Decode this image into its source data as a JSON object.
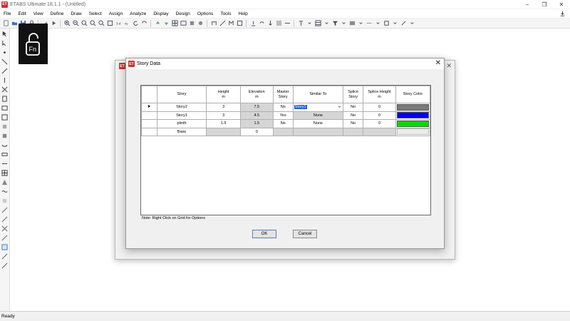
{
  "window": {
    "title": "ETABS Ultimate 18.1.1 - (Untitled)",
    "logo": "ET"
  },
  "menu": [
    "File",
    "Edit",
    "View",
    "Define",
    "Draw",
    "Select",
    "Assign",
    "Analyze",
    "Display",
    "Design",
    "Options",
    "Tools",
    "Help"
  ],
  "toolbar_icons": [
    "new-icon",
    "open-icon",
    "save-icon",
    "lock-icon",
    "pencil-icon",
    "run-icon",
    "zoom-in-icon",
    "zoom-out-icon",
    "zoom-window-icon",
    "pan-icon",
    "refresh-icon",
    "3d-view-icon",
    "rotate-icon",
    "up-arrow-icon",
    "down-arrow-icon",
    "select-icon",
    "grid-icon",
    "dropdown-icon"
  ],
  "fn_overlay": {
    "label": "Fn"
  },
  "status": {
    "text": "Ready"
  },
  "dialog": {
    "title": "Story Data",
    "logo": "ET",
    "columns": [
      {
        "line1": "Story",
        "line2": ""
      },
      {
        "line1": "Height",
        "line2": "m"
      },
      {
        "line1": "Elevation",
        "line2": "m"
      },
      {
        "line1": "Master",
        "line2": "Story"
      },
      {
        "line1": "Similar To",
        "line2": ""
      },
      {
        "line1": "Splice",
        "line2": "Story"
      },
      {
        "line1": "Splice Height",
        "line2": "m"
      },
      {
        "line1": "Story Color",
        "line2": ""
      }
    ],
    "rows": [
      {
        "story": "Story2",
        "height": "3",
        "elevation": "7.5",
        "master": "No",
        "similar": "Story1",
        "splice": "No",
        "splice_height": "0",
        "color": "#7a7a7a",
        "selected": true
      },
      {
        "story": "Story1",
        "height": "3",
        "elevation": "4.5",
        "master": "Yes",
        "similar": "None",
        "splice": "No",
        "splice_height": "0",
        "color": "#0000ff",
        "selected": false
      },
      {
        "story": "plinth",
        "height": "1.5",
        "elevation": "1.5",
        "master": "No",
        "similar": "None",
        "splice": "No",
        "splice_height": "0",
        "color": "#00dd00",
        "selected": false
      },
      {
        "story": "Base",
        "height": "",
        "elevation": "0",
        "master": "",
        "similar": "",
        "splice": "",
        "splice_height": "",
        "color": "#ececec",
        "selected": false
      }
    ],
    "note": "Note:  Right Click on Grid for Options",
    "ok_label": "OK",
    "cancel_label": "Cancel"
  },
  "colors": {
    "accent": "#1e5fd2",
    "logo_red": "#d32f2f"
  }
}
